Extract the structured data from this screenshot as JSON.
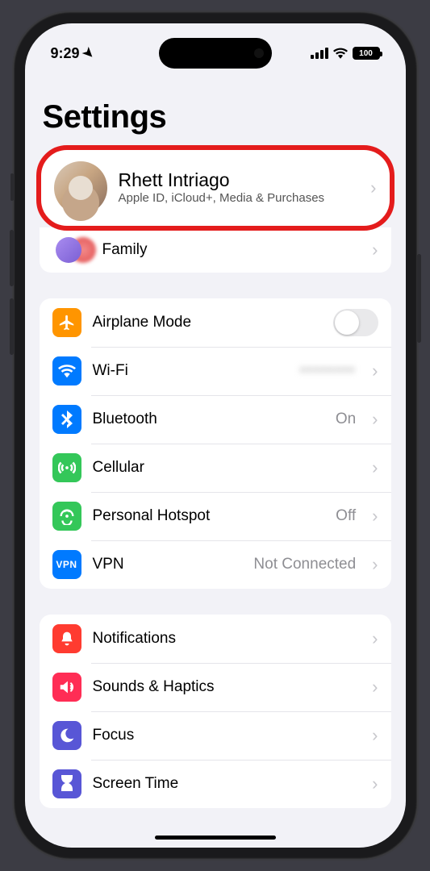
{
  "status": {
    "time": "9:29",
    "battery": "100"
  },
  "title": "Settings",
  "account": {
    "name": "Rhett Intriago",
    "subtitle": "Apple ID, iCloud+, Media & Purchases"
  },
  "family": {
    "label": "Family"
  },
  "network": {
    "airplane": "Airplane Mode",
    "wifi": {
      "label": "Wi-Fi",
      "value": "••••••••"
    },
    "bluetooth": {
      "label": "Bluetooth",
      "value": "On"
    },
    "cellular": {
      "label": "Cellular"
    },
    "hotspot": {
      "label": "Personal Hotspot",
      "value": "Off"
    },
    "vpn": {
      "label": "VPN",
      "value": "Not Connected",
      "badge": "VPN"
    }
  },
  "system": {
    "notifications": "Notifications",
    "sounds": "Sounds & Haptics",
    "focus": "Focus",
    "screentime": "Screen Time"
  }
}
